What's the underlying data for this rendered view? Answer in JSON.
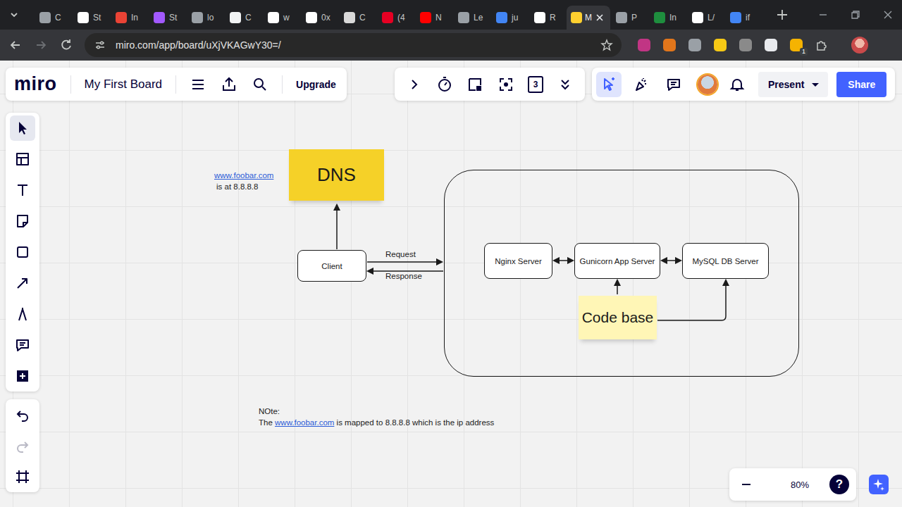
{
  "browser": {
    "tabs": [
      {
        "label": "C",
        "selected": false,
        "color": "#9aa0a6"
      },
      {
        "label": "St",
        "selected": false,
        "color": "#ffffff"
      },
      {
        "label": "In",
        "selected": false,
        "color": "#ea4335"
      },
      {
        "label": "St",
        "selected": false,
        "color": "#a259ff"
      },
      {
        "label": "lo",
        "selected": false,
        "color": "#9aa0a6"
      },
      {
        "label": "C",
        "selected": false,
        "color": "#f1f3f4"
      },
      {
        "label": "w",
        "selected": false,
        "color": "#ffffff"
      },
      {
        "label": "0x",
        "selected": false,
        "color": "#ffffff"
      },
      {
        "label": "C",
        "selected": false,
        "color": "#d9d9d9"
      },
      {
        "label": "(4",
        "selected": false,
        "color": "#e60023"
      },
      {
        "label": "N",
        "selected": false,
        "color": "#ff0000"
      },
      {
        "label": "Le",
        "selected": false,
        "color": "#9aa0a6"
      },
      {
        "label": "ju",
        "selected": false,
        "color": "#4285f4"
      },
      {
        "label": "R",
        "selected": false,
        "color": "#ffffff"
      },
      {
        "label": "M",
        "selected": true,
        "color": "#ffd02f"
      },
      {
        "label": "P",
        "selected": false,
        "color": "#9aa0a6"
      },
      {
        "label": "In",
        "selected": false,
        "color": "#1e8e3e"
      },
      {
        "label": "L/",
        "selected": false,
        "color": "#ffffff"
      },
      {
        "label": "if",
        "selected": false,
        "color": "#4285f4"
      }
    ],
    "url": "miro.com/app/board/uXjVKAGwY30=/",
    "forward_disabled": true,
    "extensions": [
      {
        "color": "#c13584"
      },
      {
        "color": "#e2761b"
      },
      {
        "color": "#9aa0a6"
      },
      {
        "color": "#f6c915"
      },
      {
        "color": "#8a8a8a"
      },
      {
        "color": "#e8eaed"
      },
      {
        "color": "#f5b301",
        "badge": "1"
      }
    ]
  },
  "miro": {
    "logo": "miro",
    "board_title": "My First Board",
    "upgrade": "Upgrade",
    "frames_count": "3",
    "collab_tools": [
      {
        "selected": true
      },
      {
        "selected": false
      },
      {
        "selected": false
      }
    ],
    "present": "Present",
    "share": "Share",
    "zoom": "80%",
    "help": "?",
    "left_tools": [
      {
        "selected": true
      },
      {
        "selected": false
      },
      {
        "selected": false
      },
      {
        "selected": false
      },
      {
        "selected": false
      },
      {
        "selected": false
      },
      {
        "selected": false
      },
      {
        "selected": false
      },
      {
        "selected": false
      }
    ],
    "history": [
      {
        "disabled": false
      },
      {
        "disabled": true
      }
    ]
  },
  "diagram": {
    "dns_note": {
      "link": "www.foobar.com",
      "text": "is at 8.8.8.8"
    },
    "stickies": [
      {
        "text": "DNS",
        "color": "#f5d128"
      },
      {
        "text": "Code base",
        "color": "#fff6b6"
      }
    ],
    "boxes": [
      {
        "label": "Client"
      },
      {
        "label": "Nginx Server"
      },
      {
        "label": "Gunicorn App Server"
      },
      {
        "label": "MySQL DB Server"
      }
    ],
    "edge_labels": [
      "Request",
      "Response"
    ],
    "note": {
      "title": "NOte:",
      "prefix": "The ",
      "link": "www.foobar.com",
      "suffix": " is mapped to 8.8.8.8 which is the ip address"
    }
  }
}
